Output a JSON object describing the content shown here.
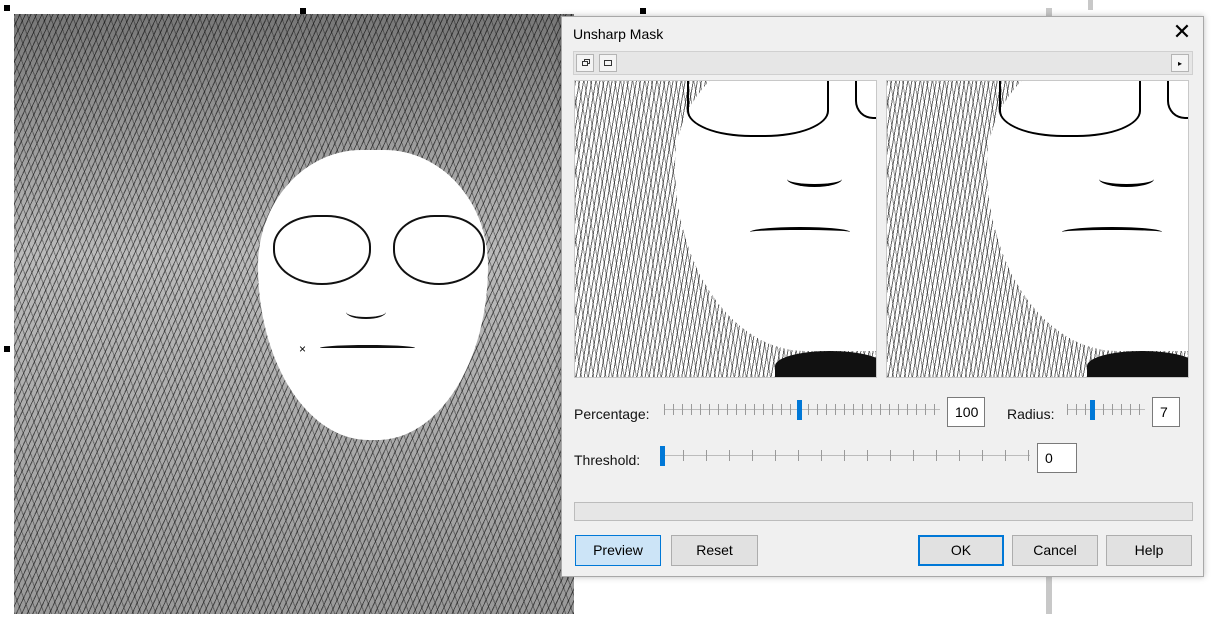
{
  "dialog": {
    "title": "Unsharp Mask",
    "close_icon": "close-icon",
    "toolbar": {
      "icons": [
        "dual-preview-icon",
        "single-preview-icon",
        "expand-arrow-icon"
      ]
    },
    "controls": {
      "percentage": {
        "label": "Percentage:",
        "value": "100",
        "fraction": 0.49
      },
      "radius": {
        "label": "Radius:",
        "value": "7",
        "fraction": 0.32
      },
      "threshold": {
        "label": "Threshold:",
        "value": "0",
        "fraction": 0.0
      }
    },
    "buttons": {
      "preview": "Preview",
      "reset": "Reset",
      "ok": "OK",
      "cancel": "Cancel",
      "help": "Help"
    }
  },
  "colors": {
    "accent": "#0078d7",
    "dialog_bg": "#f0f0f0",
    "focus_fill": "#cce4f7"
  }
}
